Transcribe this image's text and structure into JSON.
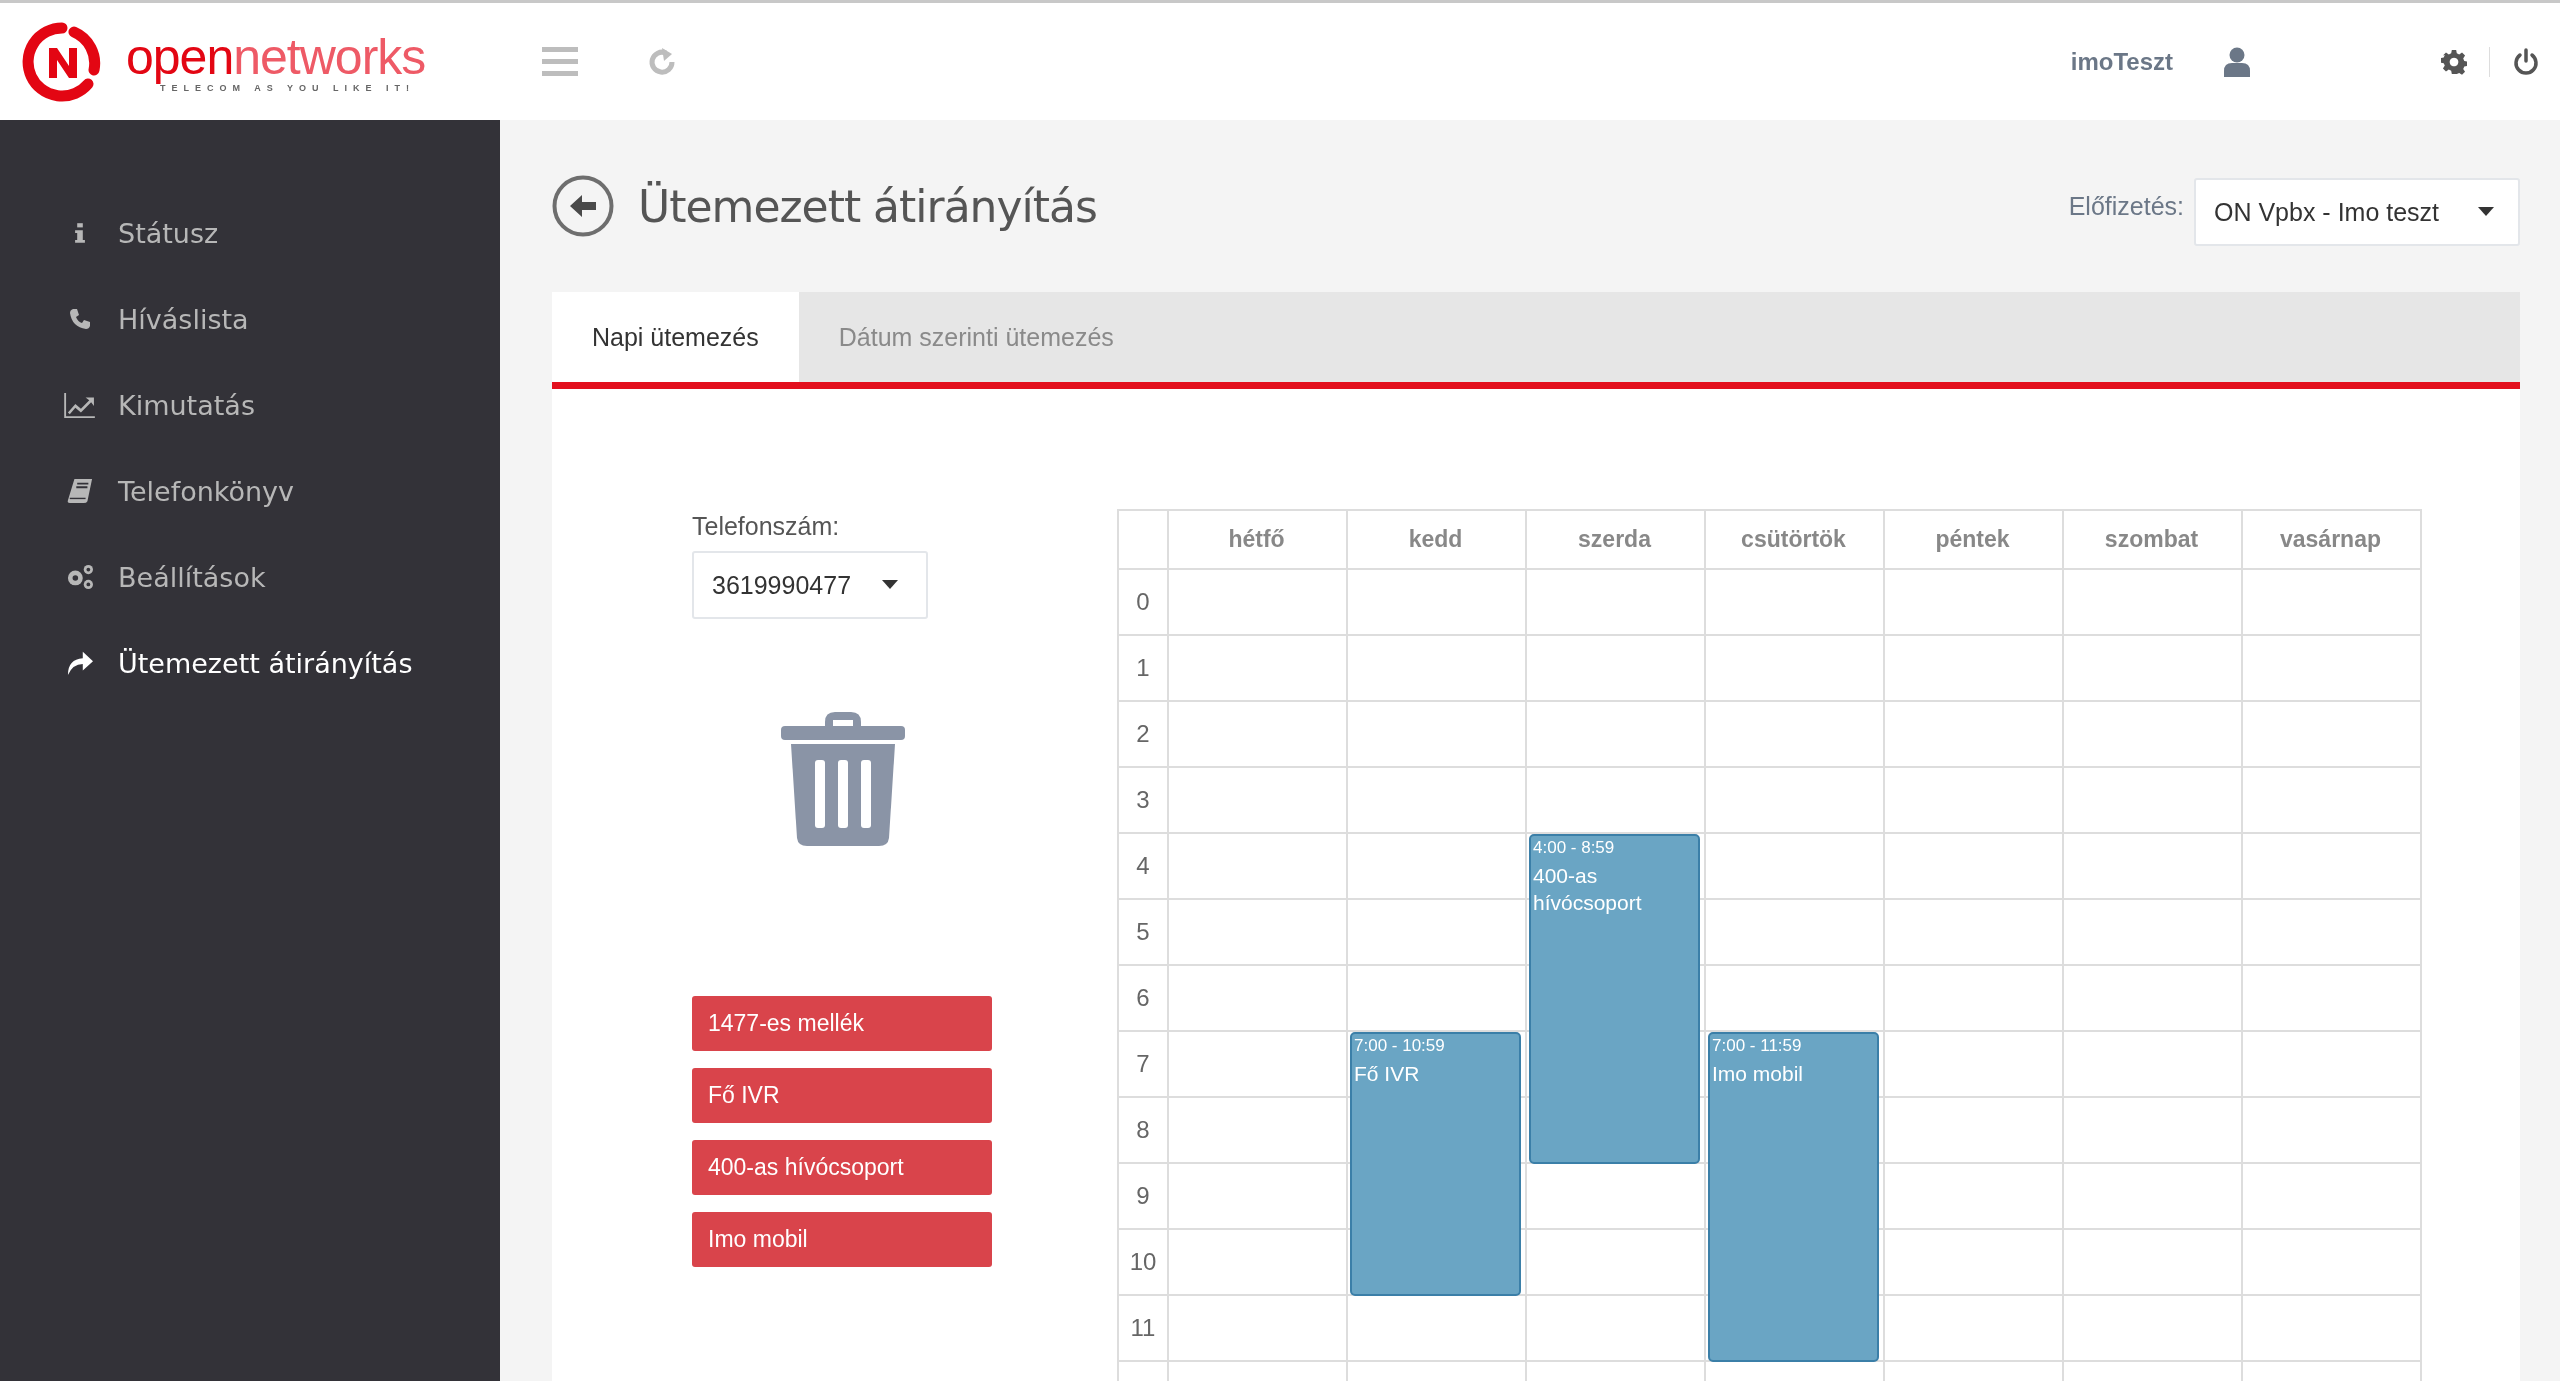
{
  "brand": {
    "name_parts": [
      "open",
      "networks"
    ],
    "tagline": "TELECOM AS YOU LIKE IT!"
  },
  "header": {
    "username": "imoTeszt"
  },
  "sidebar": {
    "items": [
      {
        "label": "Státusz",
        "selected": false
      },
      {
        "label": "Híváslista",
        "selected": false
      },
      {
        "label": "Kimutatás",
        "selected": false
      },
      {
        "label": "Telefonkönyv",
        "selected": false
      },
      {
        "label": "Beállítások",
        "selected": false
      },
      {
        "label": "Ütemezett átirányítás",
        "selected": true
      }
    ]
  },
  "page": {
    "title": "Ütemezett átirányítás",
    "subscription_label": "Előfizetés:",
    "subscription_value": "ON Vpbx - Imo teszt"
  },
  "tabs": [
    {
      "label": "Napi ütemezés",
      "selected": true
    },
    {
      "label": "Dátum szerinti ütemezés",
      "selected": false
    }
  ],
  "phone": {
    "label": "Telefonszám:",
    "value": "3619990477"
  },
  "targets": [
    "1477-es mellék",
    "Fő IVR",
    "400-as hívócsoport",
    "Imo mobil"
  ],
  "calendar": {
    "hours": [
      "0",
      "1",
      "2",
      "3",
      "4",
      "5",
      "6",
      "7",
      "8",
      "9",
      "10",
      "11"
    ],
    "days": [
      {
        "label": "hétfő"
      },
      {
        "label": "kedd",
        "events": [
          {
            "time": "7:00 - 10:59",
            "title": "Fő IVR"
          }
        ]
      },
      {
        "label": "szerda",
        "events": [
          {
            "time": "4:00 - 8:59",
            "title": "400-as hívócsoport"
          }
        ]
      },
      {
        "label": "csütörtök",
        "events": [
          {
            "time": "7:00 - 11:59",
            "title": "Imo mobil"
          }
        ]
      },
      {
        "label": "péntek"
      },
      {
        "label": "szombat"
      },
      {
        "label": "vasárnap"
      }
    ]
  }
}
